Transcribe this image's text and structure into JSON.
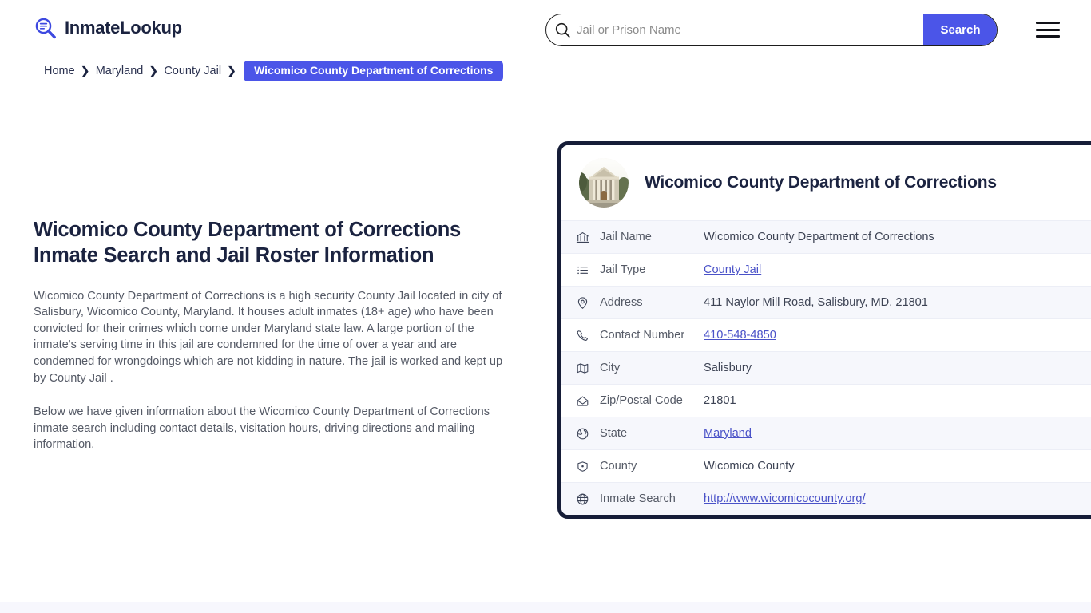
{
  "header": {
    "brand_name": "InmateLookup",
    "brand_icon": "magnifier-list-icon",
    "search": {
      "placeholder": "Jail or Prison Name",
      "value": "",
      "button_label": "Search",
      "icon": "search-icon"
    },
    "menu_icon": "hamburger-menu-icon"
  },
  "breadcrumb": {
    "items": [
      {
        "label": "Home",
        "current": false
      },
      {
        "label": "Maryland",
        "current": false
      },
      {
        "label": "County Jail",
        "current": false
      },
      {
        "label": "Wicomico County Department of Corrections",
        "current": true
      }
    ],
    "separator": "❯"
  },
  "main": {
    "title": "Wicomico County Department of Corrections Inmate Search and Jail Roster Information",
    "paragraphs": [
      "Wicomico County Department of Corrections is a high security County Jail located in city of Salisbury, Wicomico County, Maryland. It houses adult inmates (18+ age) who have been convicted for their crimes which come under Maryland state law. A large portion of the inmate's serving time in this jail are condemned for the time of over a year and are condemned for wrongdoings which are not kidding in nature. The jail is worked and kept up by County Jail .",
      "Below we have given information about the Wicomico County Department of Corrections inmate search including contact details, visitation hours, driving directions and mailing information."
    ]
  },
  "card": {
    "avatar_alt": "courthouse-building-photo",
    "title": "Wicomico County Department of Corrections",
    "rows": [
      {
        "icon": "bank-icon",
        "label": "Jail Name",
        "value": "Wicomico County Department of Corrections",
        "link": false
      },
      {
        "icon": "list-icon",
        "label": "Jail Type",
        "value": "County Jail",
        "link": true
      },
      {
        "icon": "map-pin-icon",
        "label": "Address",
        "value": "411 Naylor Mill Road, Salisbury, MD, 21801",
        "link": false
      },
      {
        "icon": "phone-icon",
        "label": "Contact Number",
        "value": "410-548-4850",
        "link": true
      },
      {
        "icon": "map-icon",
        "label": "City",
        "value": "Salisbury",
        "link": false
      },
      {
        "icon": "envelope-icon",
        "label": "Zip/Postal Code",
        "value": "21801",
        "link": false
      },
      {
        "icon": "globe-earth-icon",
        "label": "State",
        "value": "Maryland",
        "link": true
      },
      {
        "icon": "badge-icon",
        "label": "County",
        "value": "Wicomico County",
        "link": false
      },
      {
        "icon": "globe-icon",
        "label": "Inmate Search",
        "value": "http://www.wicomicocounty.org/",
        "link": true
      }
    ]
  },
  "colors": {
    "accent_blue": "#4b55e8",
    "dark_navy": "#161d38",
    "row_shade": "#f6f7fc",
    "link": "#4a52c8",
    "body_text": "#555a66"
  }
}
